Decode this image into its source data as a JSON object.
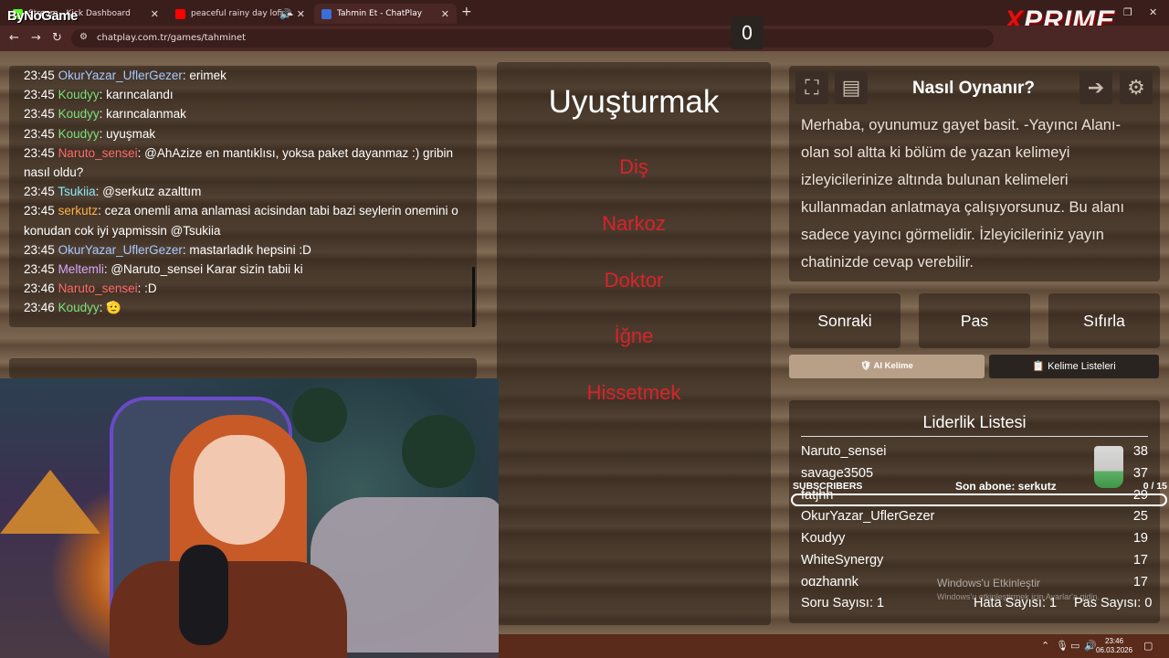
{
  "browser": {
    "brand_left": "ByNoGame",
    "brand_right": "PRIME",
    "brand_right_x": "X",
    "tabs": [
      {
        "title": "Stream - Kick Dashboard",
        "favicon_color": "#53fc18"
      },
      {
        "title": "peaceful rainy day lofi ☁",
        "favicon_color": "#ff0000"
      },
      {
        "title": "Tahmin Et - ChatPlay",
        "favicon_color": "#3a6fd8"
      }
    ],
    "new_tab": "+",
    "url": "chatplay.com.tr/games/tahminet"
  },
  "chat": {
    "messages": [
      {
        "time": "23:45",
        "user": "OkurYazar_UflerGezer",
        "color": "#a8c8ff",
        "text": "erimek"
      },
      {
        "time": "23:45",
        "user": "Koudyy",
        "color": "#7be07b",
        "text": "karıncalandı"
      },
      {
        "time": "23:45",
        "user": "Koudyy",
        "color": "#7be07b",
        "text": "karıncalanmak"
      },
      {
        "time": "23:45",
        "user": "Koudyy",
        "color": "#7be07b",
        "text": "uyuşmak"
      },
      {
        "time": "23:45",
        "user": "Naruto_sensei",
        "color": "#ff6b6b",
        "text": "@AhAzize en mantıklısı, yoksa paket dayanmaz :) gribin nasıl oldu?"
      },
      {
        "time": "23:45",
        "user": "Tsukiia",
        "color": "#8fe8ff",
        "text": "@serkutz azalttım"
      },
      {
        "time": "23:45",
        "user": "serkutz",
        "color": "#ffb347",
        "text": "ceza onemli ama anlamasi acisindan tabi bazi seylerin onemini o konudan cok iyi yapmissin @Tsukiia"
      },
      {
        "time": "23:45",
        "user": "OkurYazar_UflerGezer",
        "color": "#a8c8ff",
        "text": "mastarladık hepsini :D"
      },
      {
        "time": "23:45",
        "user": "Meltemli",
        "color": "#d6a6ff",
        "text": "@Naruto_sensei Karar sizin tabii ki"
      },
      {
        "time": "23:46",
        "user": "Naruto_sensei",
        "color": "#ff6b6b",
        "text": ":D"
      },
      {
        "time": "23:46",
        "user": "Koudyy",
        "color": "#7be07b",
        "text": "🫡"
      }
    ]
  },
  "game": {
    "score": "0",
    "main_word": "Uyuşturmak",
    "forbidden_words": [
      "Diş",
      "Narkoz",
      "Doktor",
      "İğne",
      "Hissetmek"
    ]
  },
  "howto": {
    "title": "Nasıl Oynanır?",
    "text": "Merhaba, oyunumuz gayet basit. -Yayıncı Alanı- olan sol altta ki bölüm de yazan kelimeyi izleyicilerinize altında bulunan kelimeleri kullanmadan anlatmaya çalışıyorsunuz. Bu alanı sadece yayıncı görmelidir. İzleyicileriniz yayın chatinizde cevap verebilir."
  },
  "actions": {
    "next": "Sonraki",
    "pass": "Pas",
    "reset": "Sıfırla",
    "ai_word": "🛡 AI Kelime",
    "word_lists": "📋 Kelime Listeleri"
  },
  "leaderboard": {
    "title": "Liderlik Listesi",
    "rows": [
      {
        "name": "Naruto_sensei",
        "score": "38"
      },
      {
        "name": "savage3505",
        "score": "37"
      },
      {
        "name": "fatjhh",
        "score": "29"
      },
      {
        "name": "OkurYazar_UflerGezer",
        "score": "25"
      },
      {
        "name": "Koudyy",
        "score": "19"
      },
      {
        "name": "WhiteSynergy",
        "score": "17"
      },
      {
        "name": "ogzhannk",
        "score": "17"
      }
    ],
    "question_count": "Soru Sayısı: 1",
    "error_count": "Hata Sayısı: 1",
    "pass_count": "Pas Sayısı: 0"
  },
  "overlay": {
    "subscribers_label": "SUBSCRIBERS",
    "last_sub": "Son abone: serkutz",
    "sub_progress": "0 / 15",
    "sub_progress_fraction": 0,
    "win_activate": "Windows'u Etkinleştir",
    "win_activate_sub": "Windows'u etkinleştirmek için Ayarlar'a gidin."
  },
  "taskbar": {
    "time": "23:46",
    "date": "06.03.2026"
  }
}
